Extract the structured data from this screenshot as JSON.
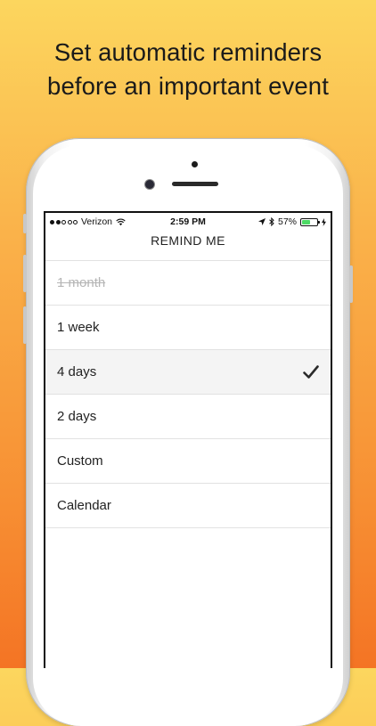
{
  "headline": {
    "line1": "Set automatic reminders",
    "line2": "before an important event"
  },
  "status_bar": {
    "carrier": "Verizon",
    "time": "2:59 PM",
    "battery_percent": "57%",
    "signal_bars_filled": 2,
    "battery_level": 0.57
  },
  "nav": {
    "title": "REMIND ME"
  },
  "options": [
    {
      "label": "1 month",
      "disabled": true,
      "selected": false
    },
    {
      "label": "1 week",
      "disabled": false,
      "selected": false
    },
    {
      "label": "4 days",
      "disabled": false,
      "selected": true
    },
    {
      "label": "2 days",
      "disabled": false,
      "selected": false
    },
    {
      "label": "Custom",
      "disabled": false,
      "selected": false
    },
    {
      "label": "Calendar",
      "disabled": false,
      "selected": false
    }
  ],
  "colors": {
    "background_top": "#fcd65e",
    "background_bottom": "#f47424",
    "battery_fill": "#4cd964"
  }
}
